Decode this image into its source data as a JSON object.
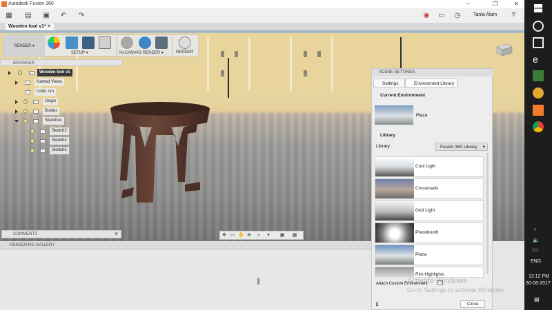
{
  "app": {
    "title": "Autodesk Fusion 360"
  },
  "user": {
    "name": "Tania Alam"
  },
  "document_tab": {
    "label": "Wooden tool v1*"
  },
  "ribbon": {
    "workspace": "RENDER",
    "setup_label": "SETUP",
    "in_canvas_label": "IN-CANVAS RENDER",
    "render_label": "RENDER"
  },
  "browser": {
    "header": "BROWSER",
    "root": "Wooden tool v1",
    "items": [
      "Named Views",
      "Units: cm",
      "Origin",
      "Bodies",
      "Sketches",
      "Sketch2",
      "Sketch4",
      "Sketch5"
    ]
  },
  "comments": {
    "label": "COMMENTS"
  },
  "gallery": {
    "label": "RENDERING GALLERY"
  },
  "scene": {
    "header": "SCENE SETTINGS",
    "tabs": [
      "Settings",
      "Environment Library"
    ],
    "current_env_title": "Current Environment",
    "current_env_name": "Plaza",
    "library_title": "Library",
    "library_label": "Library",
    "library_select": "Fusion 360 Library",
    "environments": [
      "Cool Light",
      "Crossroads",
      "Grid Light",
      "Photobooth",
      "Plaza",
      "Rim Highlights"
    ],
    "attach_label": "Attach Custom Environment",
    "close_label": "Close"
  },
  "watermark": {
    "line1": "Activate Windows",
    "line2": "Go to Settings to activate Windows."
  },
  "taskbar": {
    "lang": "ENG",
    "time": "12:12 PM",
    "date": "30-06-2017"
  },
  "colors": {
    "wood": "#5a3a30",
    "accent": "#0696d7"
  }
}
